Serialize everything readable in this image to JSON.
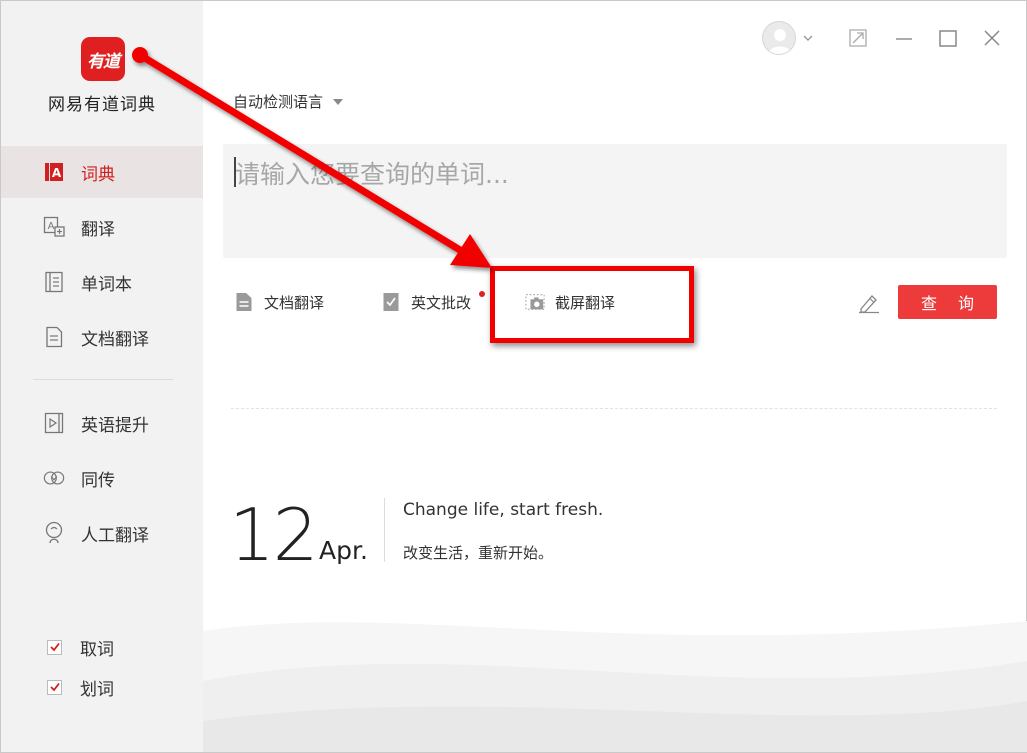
{
  "app": {
    "logo_text": "有道",
    "name": "网易有道词典"
  },
  "sidebar": {
    "items": [
      {
        "label": "词典",
        "icon": "dictionary-icon",
        "active": true
      },
      {
        "label": "翻译",
        "icon": "translate-icon"
      },
      {
        "label": "单词本",
        "icon": "wordbook-icon"
      },
      {
        "label": "文档翻译",
        "icon": "document-icon"
      },
      {
        "label": "英语提升",
        "icon": "video-play-icon"
      },
      {
        "label": "同传",
        "icon": "interpretation-icon"
      },
      {
        "label": "人工翻译",
        "icon": "human-translate-icon"
      }
    ],
    "checks": [
      {
        "label": "取词",
        "checked": true
      },
      {
        "label": "划词",
        "checked": true
      }
    ]
  },
  "toolbar": {
    "language_select": "自动检测语言",
    "search_placeholder": "请输入您要查询的单词...",
    "tools": [
      {
        "label": "文档翻译",
        "icon": "document-icon"
      },
      {
        "label": "英文批改",
        "icon": "checklist-icon",
        "badge": "red-dot"
      },
      {
        "label": "截屏翻译",
        "icon": "screenshot-camera-icon"
      }
    ],
    "query_button": "查 询"
  },
  "daily": {
    "day": "12",
    "month": "Apr.",
    "quote_en": "Change life, start fresh.",
    "quote_cn": "改变生活，重新开始。"
  },
  "colors": {
    "accent": "#ed3b3b",
    "annotation": "#f20000",
    "sidebar_bg": "#f2f2f2"
  }
}
